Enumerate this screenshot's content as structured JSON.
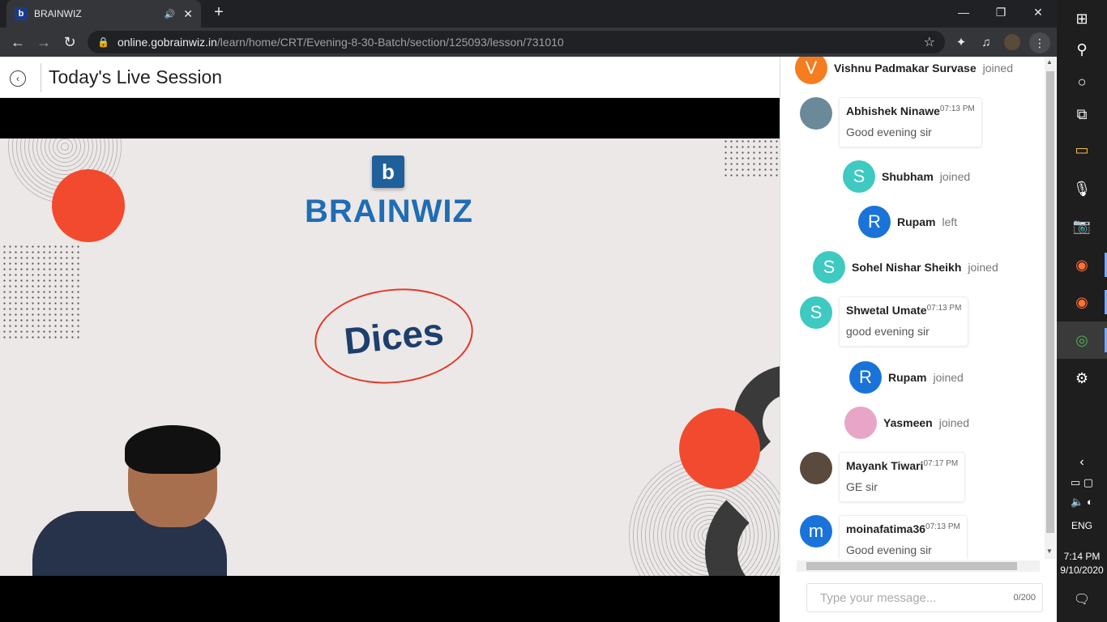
{
  "browser": {
    "tab_title": "BRAINWIZ",
    "tab_favicon": "b",
    "url_host": "online.gobrainwiz.in",
    "url_path": "/learn/home/CRT/Evening-8-30-Batch/section/125093/lesson/731010"
  },
  "page": {
    "title": "Today's Live Session"
  },
  "slide": {
    "logo_text": "BRAINWIZ",
    "logo_letter": "b",
    "topic": "Dices"
  },
  "chat": {
    "events": [
      {
        "initial": "V",
        "name": "Vishnu Padmakar Survase",
        "verb": "joined",
        "color": "#f57c1f"
      },
      {
        "initial": "S",
        "name": "Shubham",
        "verb": "joined",
        "color": "#3ec9c1"
      },
      {
        "initial": "R",
        "name": "Rupam",
        "verb": "left",
        "color": "#1a73d9"
      },
      {
        "initial": "S",
        "name": "Sohel Nishar Sheikh",
        "verb": "joined",
        "color": "#3ec9c1"
      },
      {
        "initial": "R",
        "name": "Rupam",
        "verb": "joined",
        "color": "#1a73d9"
      },
      {
        "initial": "",
        "name": "Yasmeen",
        "verb": "joined",
        "color": "#e8a5c8"
      }
    ],
    "messages": [
      {
        "initial": "",
        "name": "Abhishek Ninawe",
        "time": "07:13 PM",
        "text": "Good evening sir",
        "color": "#6a8a9a"
      },
      {
        "initial": "S",
        "name": "Shwetal Umate",
        "time": "07:13 PM",
        "text": "good evening sir",
        "color": "#3ec9c1"
      },
      {
        "initial": "",
        "name": "Mayank Tiwari",
        "time": "07:17 PM",
        "text": "GE sir",
        "color": "#5a4a3e"
      },
      {
        "initial": "m",
        "name": "moinafatima36",
        "time": "07:13 PM",
        "text": "Good evening sir",
        "color": "#1a73d9"
      }
    ],
    "input_placeholder": "Type your message...",
    "char_count": "0/200"
  },
  "taskbar": {
    "language": "ENG",
    "time": "7:14 PM",
    "date": "9/10/2020"
  }
}
